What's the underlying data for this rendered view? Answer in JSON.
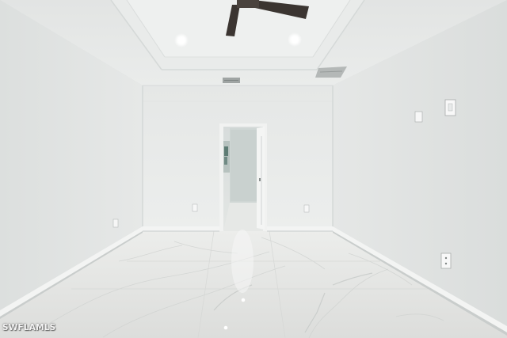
{
  "photo": {
    "subject": "",
    "watermark": "SWFLAMLS"
  },
  "colors": {
    "ceiling": "#e7e9e8",
    "wall_left": "#e3e5e4",
    "wall_back": "#e8eae9",
    "wall_right": "#e4e6e5",
    "floor": "#e2e3e1",
    "baseboard": "#f1f2f1",
    "fan_blade": "#3b3531"
  }
}
